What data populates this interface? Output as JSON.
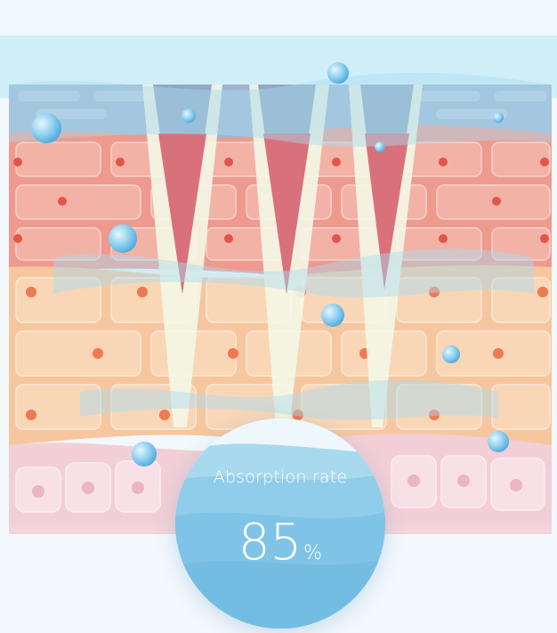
{
  "absorption": {
    "label": "Absorption rate",
    "value": "85",
    "unit": "%"
  },
  "colors": {
    "water_top": "#bfe6f3",
    "epidermis": "#ee9a8e",
    "dermis": "#f6c79e",
    "base_layer": "#f2cfd6",
    "needle": "#d9717c",
    "badge": "#7fc4e6"
  }
}
